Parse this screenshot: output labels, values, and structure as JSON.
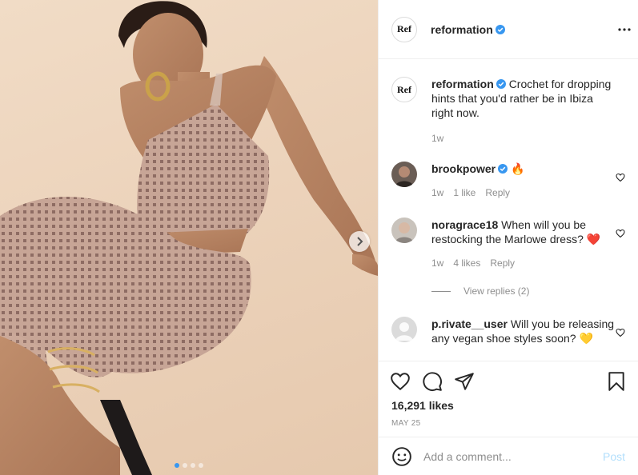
{
  "post": {
    "account": {
      "username": "reformation",
      "avatar_text": "Ref",
      "verified": true
    },
    "media": {
      "carousel_dot_count": 4,
      "active_dot_index": 0
    },
    "caption": {
      "username": "reformation",
      "text": "Crochet for dropping hints that you'd rather be in Ibiza right now.",
      "age": "1w"
    },
    "comments": [
      {
        "username": "brookpower",
        "verified": true,
        "text": "🔥",
        "age": "1w",
        "likes": "1 like",
        "reply_label": "Reply"
      },
      {
        "username": "noragrace18",
        "verified": false,
        "text": "When will you be restocking the Marlowe dress? ❤️",
        "age": "1w",
        "likes": "4 likes",
        "reply_label": "Reply"
      },
      {
        "username": "p.rivate__user",
        "verified": false,
        "text": "Will you be releasing any vegan shoe styles soon? 💛"
      }
    ],
    "view_replies_label": "View replies (2)",
    "likes_count": "16,291 likes",
    "date": "MAY 25",
    "add_comment": {
      "placeholder": "Add a comment...",
      "post_label": "Post"
    },
    "colors": {
      "verified_blue": "#3897f0",
      "post_button_disabled": "#b2dffc",
      "meta_gray": "#8e8e8e",
      "divider": "#efefef"
    },
    "icons": {
      "header_more": "more-horizontal-icon",
      "carousel_next": "chevron-right-icon",
      "like": "heart-outline-icon",
      "comment": "comment-bubble-icon",
      "share": "paper-plane-icon",
      "save": "bookmark-icon",
      "emoji": "smiley-icon"
    }
  }
}
